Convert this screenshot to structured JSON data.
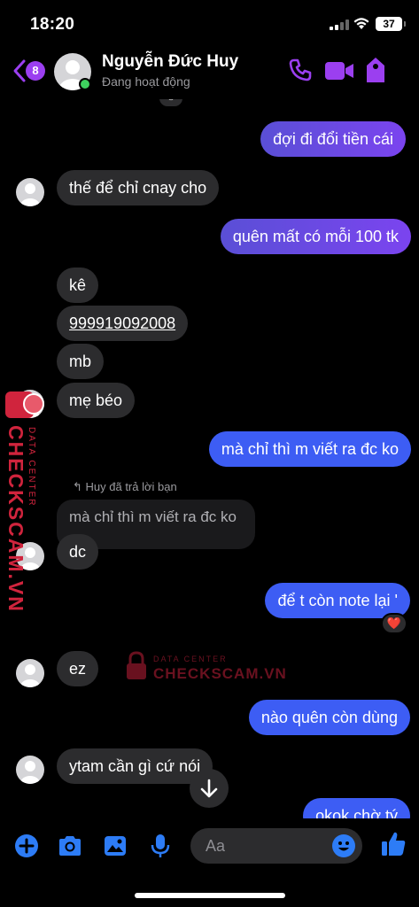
{
  "status_bar": {
    "time": "18:20",
    "battery": "37"
  },
  "header": {
    "back_count": "8",
    "contact_name": "Nguyễn Đức Huy",
    "contact_status": "Đang hoạt động"
  },
  "messages": [
    {
      "text": "đợi đi đổi tiền cái"
    },
    {
      "text": "thế để chỉ cnay cho"
    },
    {
      "text": "quên mất có mỗi 100 tk"
    },
    {
      "text": "kê"
    },
    {
      "text": "999919092008"
    },
    {
      "text": "mb"
    },
    {
      "text": "mẹ béo"
    },
    {
      "text": "mà chỉ thì m viết ra đc ko"
    },
    {
      "text": "dc"
    },
    {
      "text": "để t còn note lại '"
    },
    {
      "text": "ez"
    },
    {
      "text": "nào quên còn dùng"
    },
    {
      "text": "ytam cần gì cứ nói"
    },
    {
      "text": "okok chờ tý"
    }
  ],
  "reply": {
    "note": "Huy đã trả lời bạn",
    "quoted": "mà chỉ thì m viết ra đc ko"
  },
  "reaction": "❤️",
  "watermark": {
    "brand": "CHECKSCAM.VN",
    "tagline": "DATA CENTER"
  },
  "composer": {
    "placeholder": "Aa"
  },
  "colors": {
    "accent": "#9b3ff0",
    "outgoing_purple": "#7b44ef",
    "outgoing_blue": "#3d5df4",
    "incoming": "#2c2c2e",
    "composer_icons": "#2d7cf6"
  },
  "icons": [
    "phone-icon",
    "video-icon",
    "tag-icon",
    "plus-icon",
    "camera-icon",
    "image-icon",
    "microphone-icon",
    "emoji-icon",
    "thumbs-up-icon",
    "arrow-down-icon"
  ]
}
